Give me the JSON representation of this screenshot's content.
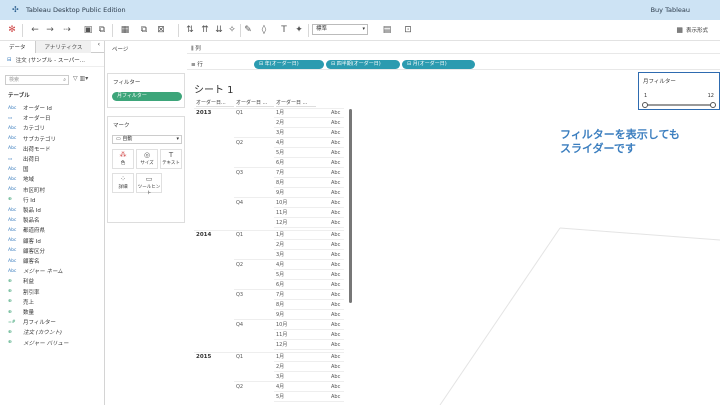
{
  "app": {
    "title": "Tableau Desktop Public Edition",
    "buy_label": "Buy Tableau",
    "show_me_label": "表示形式"
  },
  "toolbar": {
    "fit_value": "標準"
  },
  "left_pane": {
    "tabs": [
      "データ",
      "アナリティクス"
    ],
    "datasource": "注文 (サンプル - スーパー...",
    "search_placeholder": "検索",
    "tables_header": "テーブル",
    "fields": [
      {
        "type": "Abc",
        "name": "オーダー Id"
      },
      {
        "type": "date",
        "name": "オーダー日"
      },
      {
        "type": "Abc",
        "name": "カテゴリ"
      },
      {
        "type": "Abc",
        "name": "サブカテゴリ"
      },
      {
        "type": "Abc",
        "name": "出荷モード"
      },
      {
        "type": "date",
        "name": "出荷日"
      },
      {
        "type": "Abc",
        "name": "国"
      },
      {
        "type": "Abc",
        "name": "地域"
      },
      {
        "type": "Abc",
        "name": "市区町村"
      },
      {
        "type": "#",
        "name": "行 Id"
      },
      {
        "type": "Abc",
        "name": "製品 Id"
      },
      {
        "type": "Abc",
        "name": "製品名"
      },
      {
        "type": "Abc",
        "name": "都道府県"
      },
      {
        "type": "Abc",
        "name": "顧客 Id"
      },
      {
        "type": "Abc",
        "name": "顧客区分"
      },
      {
        "type": "Abc",
        "name": "顧客名"
      },
      {
        "type": "Abc",
        "name": "メジャー ネーム",
        "italic": true
      },
      {
        "type": "#",
        "name": "利益"
      },
      {
        "type": "#",
        "name": "割引率"
      },
      {
        "type": "#",
        "name": "売上"
      },
      {
        "type": "#",
        "name": "数量"
      },
      {
        "type": "=#",
        "name": "月フィルター"
      },
      {
        "type": "#",
        "name": "注文 (カウント)",
        "italic": true
      },
      {
        "type": "#",
        "name": "メジャー バリュー",
        "italic": true
      }
    ]
  },
  "shelves": {
    "pages_label": "ページ",
    "filters_label": "フィルター",
    "filter_pill": "月フィルター",
    "marks_label": "マーク",
    "mark_type": "自動",
    "mark_buttons": [
      "色",
      "サイズ",
      "テキスト",
      "詳細",
      "ツールヒント"
    ],
    "columns_label": "列",
    "rows_label": "行",
    "row_pills": [
      "⊟ 年(オーダー日)",
      "⊟ 四半期(オーダー日)",
      "⊟ 月(オーダー日)"
    ]
  },
  "sheet": {
    "title": "シート 1",
    "headers": [
      "オーダー日...",
      "オーダー日 ...",
      "オーダー日 ..."
    ],
    "abc": "Abc",
    "years": [
      {
        "year": "2013",
        "quarters": [
          "Q1",
          "Q2",
          "Q3",
          "Q4"
        ]
      },
      {
        "year": "2014",
        "quarters": [
          "Q1",
          "Q2",
          "Q3",
          "Q4"
        ]
      },
      {
        "year": "2015",
        "quarters": [
          "Q1",
          "Q2"
        ]
      }
    ],
    "months": [
      "1月",
      "2月",
      "3月",
      "4月",
      "5月",
      "6月",
      "7月",
      "8月",
      "9月",
      "10月",
      "11月",
      "12月"
    ]
  },
  "annotation": {
    "line1": "フィルターを表示しても",
    "line2": "スライダーです"
  },
  "slider": {
    "title": "月フィルター",
    "min": "1",
    "max": "12"
  }
}
